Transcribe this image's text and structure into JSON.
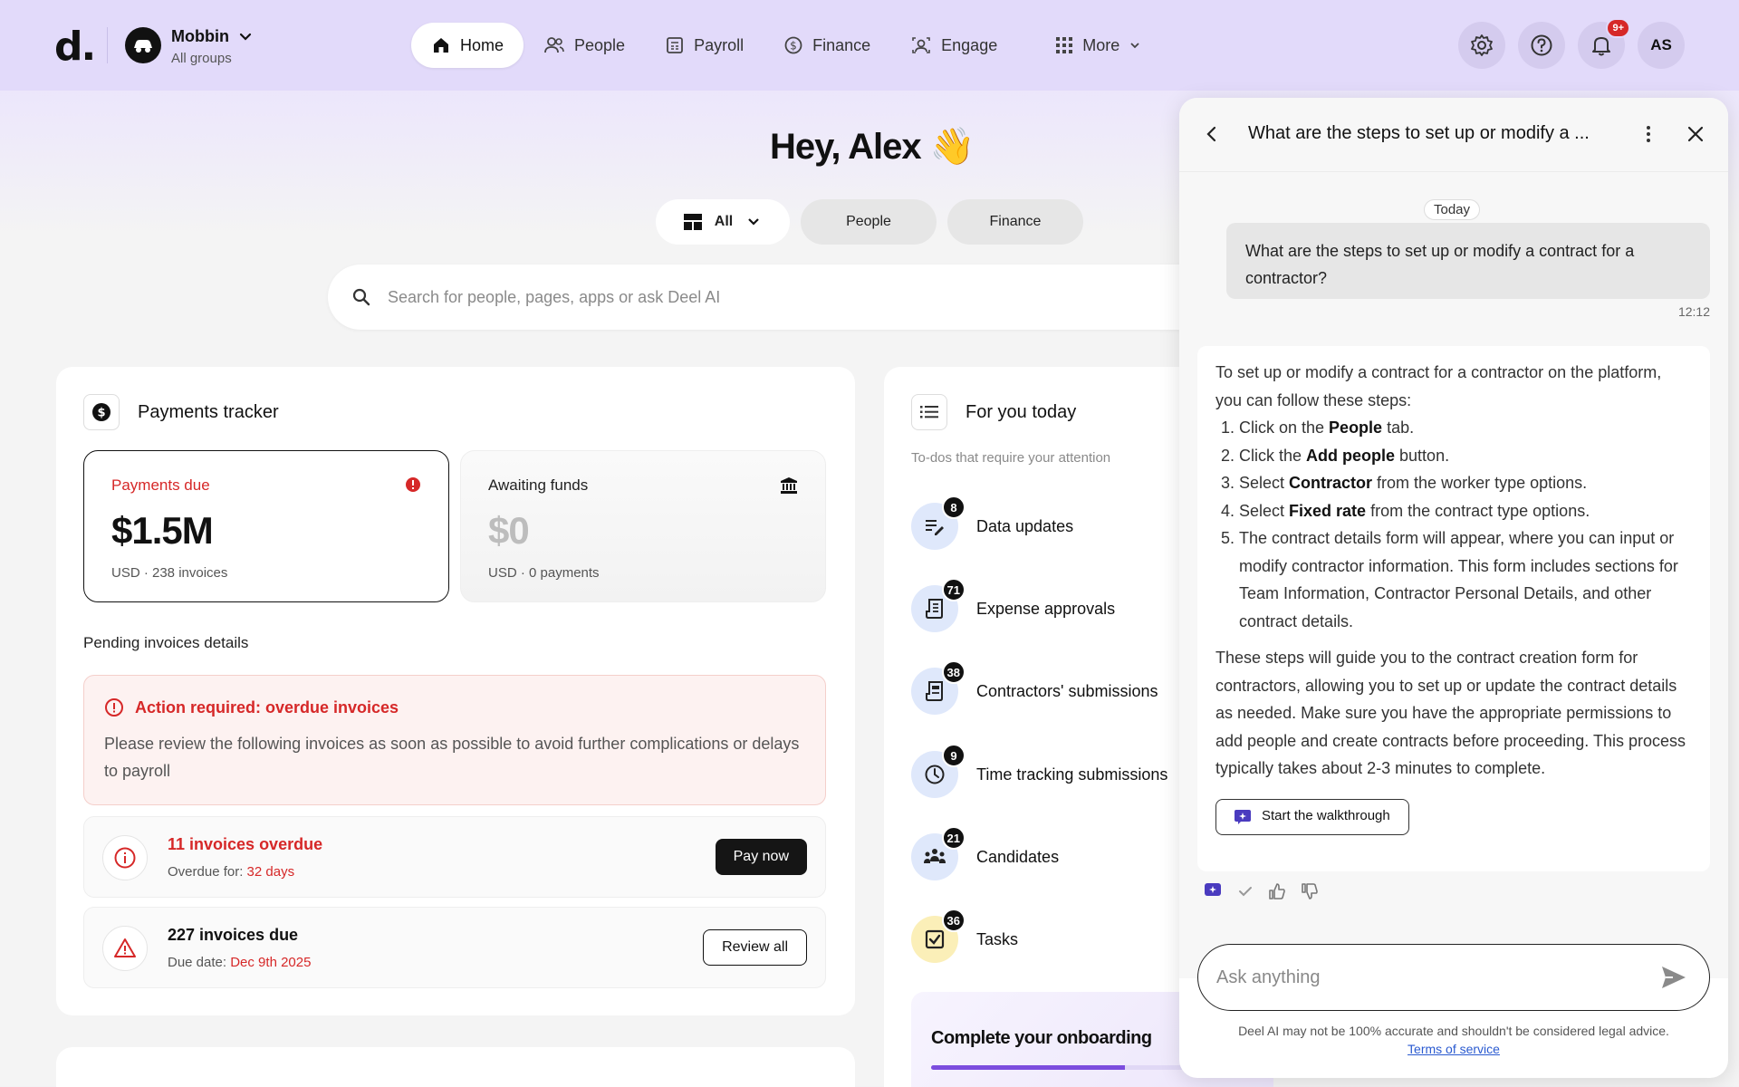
{
  "brand": {
    "logo": "d.",
    "org_name": "Mobbin",
    "org_sub": "All groups"
  },
  "nav": {
    "items": [
      {
        "label": "Home",
        "icon": "home-icon",
        "active": true
      },
      {
        "label": "People",
        "icon": "people-icon"
      },
      {
        "label": "Payroll",
        "icon": "payroll-icon"
      },
      {
        "label": "Finance",
        "icon": "finance-icon"
      },
      {
        "label": "Engage",
        "icon": "engage-icon"
      },
      {
        "label": "More",
        "icon": "grid-icon"
      }
    ]
  },
  "header_actions": {
    "notifications_badge": "9+",
    "avatar_initials": "AS"
  },
  "greeting": {
    "text": "Hey, Alex",
    "emoji": "👋"
  },
  "filters": {
    "all": "All",
    "people": "People",
    "finance": "Finance"
  },
  "search": {
    "placeholder": "Search for people, pages, apps or ask Deel AI"
  },
  "payments": {
    "title": "Payments tracker",
    "due": {
      "label": "Payments due",
      "value": "$1.5M",
      "sub": "USD · 238 invoices"
    },
    "await": {
      "label": "Awaiting funds",
      "value": "$0",
      "sub": "USD · 0 payments"
    },
    "pending_title": "Pending invoices details",
    "alert": {
      "title": "Action required: overdue invoices",
      "text": "Please review the following invoices as soon as possible to avoid further complications or delays to payroll"
    },
    "rows": [
      {
        "title": "11 invoices overdue",
        "sub_label": "Overdue for: ",
        "sub_value": "32 days",
        "button": "Pay now"
      },
      {
        "title": "227 invoices due",
        "sub_label": "Due date: ",
        "sub_value": "Dec 9th 2025",
        "button": "Review all"
      }
    ]
  },
  "today": {
    "title": "For you today",
    "subtitle": "To-dos that require your attention",
    "items": [
      {
        "label": "Data updates",
        "count": "8",
        "icon": "edit-list-icon"
      },
      {
        "label": "Expense approvals",
        "count": "71",
        "icon": "receipt-icon"
      },
      {
        "label": "Contractors' submissions",
        "count": "38",
        "icon": "document-icon"
      },
      {
        "label": "Time tracking submissions",
        "count": "9",
        "icon": "clock-icon"
      },
      {
        "label": "Candidates",
        "count": "21",
        "icon": "group-icon"
      },
      {
        "label": "Tasks",
        "count": "36",
        "icon": "checkbox-icon"
      }
    ],
    "onboarding": {
      "title": "Complete your onboarding",
      "progress": 0.6
    }
  },
  "chat": {
    "title": "What are the steps to set up or modify a ...",
    "day": "Today",
    "user_message": "What are the steps to set up or modify a contract for a contractor?",
    "user_time": "12:12",
    "ai": {
      "intro": "To set up or modify a contract for a contractor on the platform, you can follow these steps:",
      "steps": [
        {
          "pre": "Click on the ",
          "bold": "People",
          "post": " tab."
        },
        {
          "pre": "Click the ",
          "bold": "Add people",
          "post": " button."
        },
        {
          "pre": "Select ",
          "bold": "Contractor",
          "post": " from the worker type options."
        },
        {
          "pre": "Select ",
          "bold": "Fixed rate",
          "post": " from the contract type options."
        },
        {
          "pre": "The contract details form will appear, where you can input or modify contractor information. This form includes sections for Team Information, Contractor Personal Details, and other contract details.",
          "bold": "",
          "post": ""
        }
      ],
      "outro": "These steps will guide you to the contract creation form for contractors, allowing you to set up or update the contract details as needed. Make sure you have the appropriate permissions to add people and create contracts before proceeding. This process typically takes about 2-3 minutes to complete.",
      "walkthrough_button": "Start the walkthrough"
    },
    "input_placeholder": "Ask anything",
    "disclaimer": "Deel AI may not be 100% accurate and shouldn't be considered legal advice.",
    "terms": "Terms of service"
  },
  "colors": {
    "accent_purple": "#7c4dde",
    "danger": "#d62828",
    "topbar": "#e2dafa"
  }
}
